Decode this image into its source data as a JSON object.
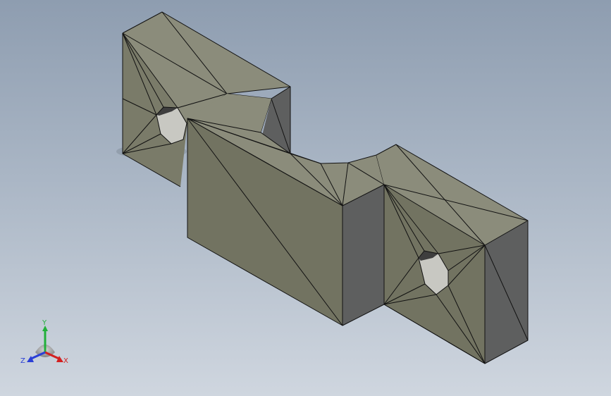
{
  "viewport": {
    "background_top": "#8e9db0",
    "background_bottom": "#cfd6df"
  },
  "model": {
    "face_colors": {
      "front": "#727361",
      "top": "#8b8c7b",
      "side": "#5e5f5f",
      "left_block_front": "#7a7b69",
      "hole": "#c8c8c2",
      "hole_shadow": "#3e3e3e"
    },
    "edge_color": "#111111"
  },
  "triad": {
    "x_label": "X",
    "y_label": "Y",
    "z_label": "Z",
    "x_color": "#d32020",
    "y_color": "#22b03a",
    "z_color": "#2a3fd6"
  }
}
